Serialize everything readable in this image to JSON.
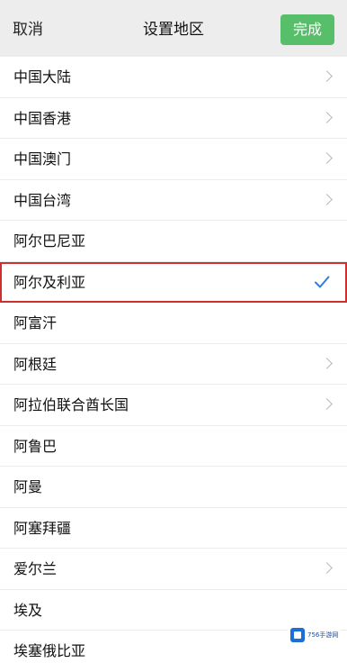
{
  "header": {
    "cancel_label": "取消",
    "title": "设置地区",
    "done_label": "完成"
  },
  "regions": [
    {
      "label": "中国大陆",
      "chevron": true,
      "selected": false
    },
    {
      "label": "中国香港",
      "chevron": true,
      "selected": false
    },
    {
      "label": "中国澳门",
      "chevron": true,
      "selected": false
    },
    {
      "label": "中国台湾",
      "chevron": true,
      "selected": false
    },
    {
      "label": "阿尔巴尼亚",
      "chevron": false,
      "selected": false
    },
    {
      "label": "阿尔及利亚",
      "chevron": false,
      "selected": true
    },
    {
      "label": "阿富汗",
      "chevron": false,
      "selected": false
    },
    {
      "label": "阿根廷",
      "chevron": true,
      "selected": false
    },
    {
      "label": "阿拉伯联合酋长国",
      "chevron": true,
      "selected": false
    },
    {
      "label": "阿鲁巴",
      "chevron": false,
      "selected": false
    },
    {
      "label": "阿曼",
      "chevron": false,
      "selected": false
    },
    {
      "label": "阿塞拜疆",
      "chevron": false,
      "selected": false
    },
    {
      "label": "爱尔兰",
      "chevron": true,
      "selected": false
    },
    {
      "label": "埃及",
      "chevron": false,
      "selected": false
    },
    {
      "label": "埃塞俄比亚",
      "chevron": false,
      "selected": false
    }
  ],
  "watermark": {
    "text": "756手游网"
  },
  "colors": {
    "accent_green": "#57be6a",
    "check_blue": "#2f7de1",
    "highlight_red": "#cf2f2f",
    "chevron_gray": "#b9b9b9"
  }
}
